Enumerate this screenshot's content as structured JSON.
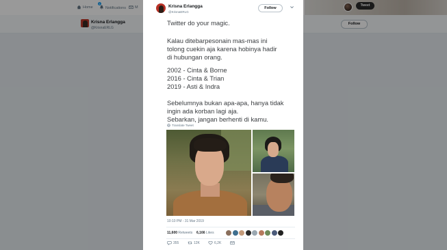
{
  "topnav": {
    "items": [
      {
        "icon": "home-icon",
        "label": "Home"
      },
      {
        "icon": "bell-icon",
        "label": "Notifications",
        "badge": "1"
      },
      {
        "icon": "envelope-icon",
        "label": "M"
      }
    ],
    "tweet_button": "Tweet"
  },
  "profile_bar": {
    "name": "Krisna Erlangga",
    "handle": "@KrisnaERLG",
    "follow_label": "Follow"
  },
  "tweet": {
    "author": {
      "name": "Krisna Erlangga",
      "handle": "@KrisnaERLG"
    },
    "follow_label": "Follow",
    "lines": [
      "Twitter do your magic.",
      "Kalau ditebarpesonain mas-mas ini",
      "tolong cuekin aja karena hobinya hadir",
      "di hubungan orang.",
      "2002 - Cinta & Borne",
      "2016 - Cinta & Trian",
      "2019 - Asti & Indra",
      "Sebelumnya bukan apa-apa, hanya tidak",
      "ingin ada korban lagi aja.",
      "Sebarkan, jangan berhenti di kamu."
    ],
    "translate_label": "Translate Tweet",
    "timestamp": "10:10 PM - 31 Mar 2019",
    "retweets": {
      "count": "11,600",
      "label": "Retweets"
    },
    "likes": {
      "count": "6,166",
      "label": "Likes"
    },
    "liker_colors": [
      "#8a6f5c",
      "#3f6f8f",
      "#c39a7a",
      "#2b2b2b",
      "#9aa7b1",
      "#b57a5e",
      "#6d8a5a",
      "#4a5a7a",
      "#222222"
    ],
    "actions": {
      "reply": {
        "icon": "reply-icon",
        "count": "355"
      },
      "retweet": {
        "icon": "retweet-icon",
        "count": "12K"
      },
      "like": {
        "icon": "heart-icon",
        "count": "6,2K"
      },
      "message": {
        "icon": "message-icon"
      }
    }
  },
  "colors": {
    "accent": "#1da1f2",
    "text": "#14171a",
    "muted": "#657786"
  }
}
